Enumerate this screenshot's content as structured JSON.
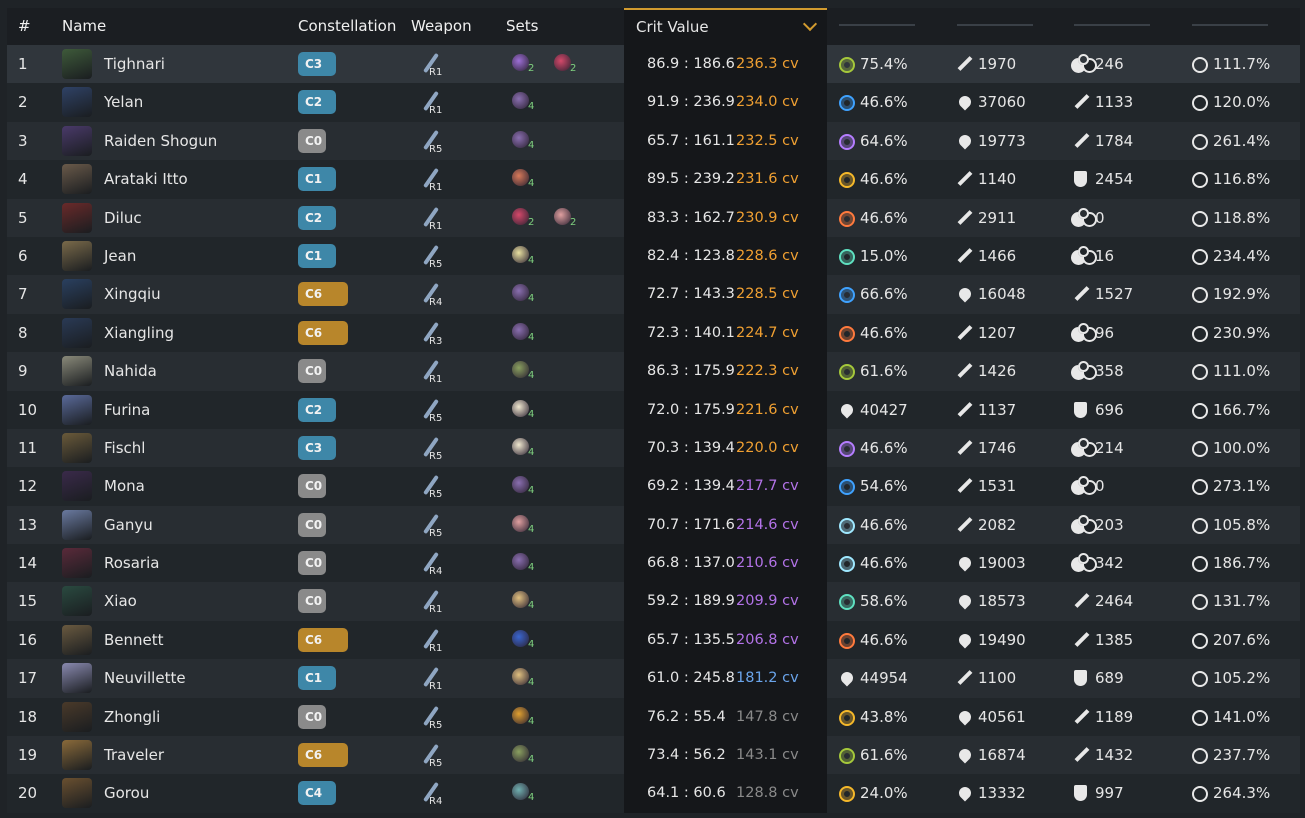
{
  "headers": {
    "num": "#",
    "name": "Name",
    "constellation": "Constellation",
    "weapon": "Weapon",
    "sets": "Sets",
    "crit": "Crit Value"
  },
  "colors": {
    "c_blue": "#3e87a8",
    "c_gray": "#8a8a8a",
    "c_gold": "#b8862b",
    "cv_orange": "#f0a032",
    "cv_purple": "#b373e8",
    "cv_blue": "#6aa4ea",
    "cv_gray": "#8a8a8a"
  },
  "rows": [
    {
      "n": "1",
      "name": "Tighnari",
      "c": "C3",
      "ct": "blue",
      "r": "R1",
      "sets": [
        {
          "k": "2",
          "col": "#9d6fd6"
        },
        {
          "k": "2",
          "col": "#d4496a"
        }
      ],
      "ratio": "86.9 : 186.6",
      "cv": "236.3 cv",
      "cvc": "orange",
      "s": [
        {
          "i": "dendro-icon",
          "v": "75.4%"
        },
        {
          "i": "atk-icon",
          "v": "1970"
        },
        {
          "i": "em-icon",
          "v": "246"
        },
        {
          "i": "er-icon",
          "v": "111.7%"
        }
      ]
    },
    {
      "n": "2",
      "name": "Yelan",
      "c": "C2",
      "ct": "blue",
      "r": "R1",
      "sets": [
        {
          "k": "4",
          "col": "#8a6fb0"
        }
      ],
      "ratio": "91.9 : 236.9",
      "cv": "234.0 cv",
      "cvc": "orange",
      "s": [
        {
          "i": "hydro-icon",
          "v": "46.6%"
        },
        {
          "i": "hp-icon",
          "v": "37060"
        },
        {
          "i": "atk-icon",
          "v": "1133"
        },
        {
          "i": "er-icon",
          "v": "120.0%"
        }
      ]
    },
    {
      "n": "3",
      "name": "Raiden Shogun",
      "c": "C0",
      "ct": "gray",
      "r": "R5",
      "sets": [
        {
          "k": "4",
          "col": "#8a6fb0"
        }
      ],
      "ratio": "65.7 : 161.1",
      "cv": "232.5 cv",
      "cvc": "orange",
      "s": [
        {
          "i": "electro-icon",
          "v": "64.6%"
        },
        {
          "i": "hp-icon",
          "v": "19773"
        },
        {
          "i": "atk-icon",
          "v": "1784"
        },
        {
          "i": "er-icon",
          "v": "261.4%"
        }
      ]
    },
    {
      "n": "4",
      "name": "Arataki Itto",
      "c": "C1",
      "ct": "blue",
      "r": "R1",
      "sets": [
        {
          "k": "4",
          "col": "#d77a5a"
        }
      ],
      "ratio": "89.5 : 239.2",
      "cv": "231.6 cv",
      "cvc": "orange",
      "s": [
        {
          "i": "geo-icon",
          "v": "46.6%"
        },
        {
          "i": "atk-icon",
          "v": "1140"
        },
        {
          "i": "def-icon",
          "v": "2454"
        },
        {
          "i": "er-icon",
          "v": "116.8%"
        }
      ]
    },
    {
      "n": "5",
      "name": "Diluc",
      "c": "C2",
      "ct": "blue",
      "r": "R1",
      "sets": [
        {
          "k": "2",
          "col": "#d4496a"
        },
        {
          "k": "2",
          "col": "#e0a0a0"
        }
      ],
      "ratio": "83.3 : 162.7",
      "cv": "230.9 cv",
      "cvc": "orange",
      "s": [
        {
          "i": "pyro-icon",
          "v": "46.6%"
        },
        {
          "i": "atk-icon",
          "v": "2911"
        },
        {
          "i": "em-icon",
          "v": "0"
        },
        {
          "i": "er-icon",
          "v": "118.8%"
        }
      ]
    },
    {
      "n": "6",
      "name": "Jean",
      "c": "C1",
      "ct": "blue",
      "r": "R5",
      "sets": [
        {
          "k": "4",
          "col": "#e8e0a0"
        }
      ],
      "ratio": "82.4 : 123.8",
      "cv": "228.6 cv",
      "cvc": "orange",
      "s": [
        {
          "i": "anemo-icon",
          "v": "15.0%"
        },
        {
          "i": "atk-icon",
          "v": "1466"
        },
        {
          "i": "em-icon",
          "v": "16"
        },
        {
          "i": "er-icon",
          "v": "234.4%"
        }
      ]
    },
    {
      "n": "7",
      "name": "Xingqiu",
      "c": "C6",
      "ct": "gold",
      "r": "R4",
      "sets": [
        {
          "k": "4",
          "col": "#8a6fb0"
        }
      ],
      "ratio": "72.7 : 143.3",
      "cv": "228.5 cv",
      "cvc": "orange",
      "s": [
        {
          "i": "hydro-icon",
          "v": "66.6%"
        },
        {
          "i": "hp-icon",
          "v": "16048"
        },
        {
          "i": "atk-icon",
          "v": "1527"
        },
        {
          "i": "er-icon",
          "v": "192.9%"
        }
      ]
    },
    {
      "n": "8",
      "name": "Xiangling",
      "c": "C6",
      "ct": "gold",
      "r": "R3",
      "sets": [
        {
          "k": "4",
          "col": "#8a6fb0"
        }
      ],
      "ratio": "72.3 : 140.1",
      "cv": "224.7 cv",
      "cvc": "orange",
      "s": [
        {
          "i": "pyro-icon",
          "v": "46.6%"
        },
        {
          "i": "atk-icon",
          "v": "1207"
        },
        {
          "i": "em-icon",
          "v": "96"
        },
        {
          "i": "er-icon",
          "v": "230.9%"
        }
      ]
    },
    {
      "n": "9",
      "name": "Nahida",
      "c": "C0",
      "ct": "gray",
      "r": "R1",
      "sets": [
        {
          "k": "4",
          "col": "#8aa060"
        }
      ],
      "ratio": "86.3 : 175.9",
      "cv": "222.3 cv",
      "cvc": "orange",
      "s": [
        {
          "i": "dendro-icon",
          "v": "61.6%"
        },
        {
          "i": "atk-icon",
          "v": "1426"
        },
        {
          "i": "em-icon",
          "v": "358"
        },
        {
          "i": "er-icon",
          "v": "111.0%"
        }
      ]
    },
    {
      "n": "10",
      "name": "Furina",
      "c": "C2",
      "ct": "blue",
      "r": "R5",
      "sets": [
        {
          "k": "4",
          "col": "#f0e8d0"
        }
      ],
      "ratio": "72.0 : 175.9",
      "cv": "221.6 cv",
      "cvc": "orange",
      "s": [
        {
          "i": "hp-icon",
          "v": "40427"
        },
        {
          "i": "atk-icon",
          "v": "1137"
        },
        {
          "i": "def-icon",
          "v": "696"
        },
        {
          "i": "er-icon",
          "v": "166.7%"
        }
      ]
    },
    {
      "n": "11",
      "name": "Fischl",
      "c": "C3",
      "ct": "blue",
      "r": "R5",
      "sets": [
        {
          "k": "4",
          "col": "#f0e8d0"
        }
      ],
      "ratio": "70.3 : 139.4",
      "cv": "220.0 cv",
      "cvc": "orange",
      "s": [
        {
          "i": "electro-icon",
          "v": "46.6%"
        },
        {
          "i": "atk-icon",
          "v": "1746"
        },
        {
          "i": "em-icon",
          "v": "214"
        },
        {
          "i": "er-icon",
          "v": "100.0%"
        }
      ]
    },
    {
      "n": "12",
      "name": "Mona",
      "c": "C0",
      "ct": "gray",
      "r": "R5",
      "sets": [
        {
          "k": "4",
          "col": "#8a6fb0"
        }
      ],
      "ratio": "69.2 : 139.4",
      "cv": "217.7 cv",
      "cvc": "purple",
      "s": [
        {
          "i": "hydro-icon",
          "v": "54.6%"
        },
        {
          "i": "atk-icon",
          "v": "1531"
        },
        {
          "i": "em-icon",
          "v": "0"
        },
        {
          "i": "er-icon",
          "v": "273.1%"
        }
      ]
    },
    {
      "n": "13",
      "name": "Ganyu",
      "c": "C0",
      "ct": "gray",
      "r": "R5",
      "sets": [
        {
          "k": "4",
          "col": "#e0a0a0"
        }
      ],
      "ratio": "70.7 : 171.6",
      "cv": "214.6 cv",
      "cvc": "purple",
      "s": [
        {
          "i": "cryo-icon",
          "v": "46.6%"
        },
        {
          "i": "atk-icon",
          "v": "2082"
        },
        {
          "i": "em-icon",
          "v": "203"
        },
        {
          "i": "er-icon",
          "v": "105.8%"
        }
      ]
    },
    {
      "n": "14",
      "name": "Rosaria",
      "c": "C0",
      "ct": "gray",
      "r": "R4",
      "sets": [
        {
          "k": "4",
          "col": "#8a6fb0"
        }
      ],
      "ratio": "66.8 : 137.0",
      "cv": "210.6 cv",
      "cvc": "purple",
      "s": [
        {
          "i": "cryo-icon",
          "v": "46.6%"
        },
        {
          "i": "hp-icon",
          "v": "19003"
        },
        {
          "i": "em-icon",
          "v": "342"
        },
        {
          "i": "er-icon",
          "v": "186.7%"
        }
      ]
    },
    {
      "n": "15",
      "name": "Xiao",
      "c": "C0",
      "ct": "gray",
      "r": "R1",
      "sets": [
        {
          "k": "4",
          "col": "#e0c080"
        }
      ],
      "ratio": "59.2 : 189.9",
      "cv": "209.9 cv",
      "cvc": "purple",
      "s": [
        {
          "i": "anemo-icon",
          "v": "58.6%"
        },
        {
          "i": "hp-icon",
          "v": "18573"
        },
        {
          "i": "atk-icon",
          "v": "2464"
        },
        {
          "i": "er-icon",
          "v": "131.7%"
        }
      ]
    },
    {
      "n": "16",
      "name": "Bennett",
      "c": "C6",
      "ct": "gold",
      "r": "R1",
      "sets": [
        {
          "k": "4",
          "col": "#3a66d0"
        }
      ],
      "ratio": "65.7 : 135.5",
      "cv": "206.8 cv",
      "cvc": "purple",
      "s": [
        {
          "i": "pyro-icon",
          "v": "46.6%"
        },
        {
          "i": "hp-icon",
          "v": "19490"
        },
        {
          "i": "atk-icon",
          "v": "1385"
        },
        {
          "i": "er-icon",
          "v": "207.6%"
        }
      ]
    },
    {
      "n": "17",
      "name": "Neuvillette",
      "c": "C1",
      "ct": "blue",
      "r": "R1",
      "sets": [
        {
          "k": "4",
          "col": "#e0c080"
        }
      ],
      "ratio": "61.0 : 245.8",
      "cv": "181.2 cv",
      "cvc": "blue",
      "s": [
        {
          "i": "hp-icon",
          "v": "44954"
        },
        {
          "i": "atk-icon",
          "v": "1100"
        },
        {
          "i": "def-icon",
          "v": "689"
        },
        {
          "i": "er-icon",
          "v": "105.2%"
        }
      ]
    },
    {
      "n": "18",
      "name": "Zhongli",
      "c": "C0",
      "ct": "gray",
      "r": "R5",
      "sets": [
        {
          "k": "4",
          "col": "#e0a030"
        }
      ],
      "ratio": "76.2 : 55.4",
      "cv": "147.8 cv",
      "cvc": "gray",
      "s": [
        {
          "i": "geo-icon",
          "v": "43.8%"
        },
        {
          "i": "hp-icon",
          "v": "40561"
        },
        {
          "i": "atk-icon",
          "v": "1189"
        },
        {
          "i": "er-icon",
          "v": "141.0%"
        }
      ]
    },
    {
      "n": "19",
      "name": "Traveler",
      "c": "C6",
      "ct": "gold",
      "r": "R5",
      "sets": [
        {
          "k": "4",
          "col": "#8aa060"
        }
      ],
      "ratio": "73.4 : 56.2",
      "cv": "143.1 cv",
      "cvc": "gray",
      "s": [
        {
          "i": "dendro-icon",
          "v": "61.6%"
        },
        {
          "i": "hp-icon",
          "v": "16874"
        },
        {
          "i": "atk-icon",
          "v": "1432"
        },
        {
          "i": "er-icon",
          "v": "237.7%"
        }
      ]
    },
    {
      "n": "20",
      "name": "Gorou",
      "c": "C4",
      "ct": "blue",
      "r": "R4",
      "sets": [
        {
          "k": "4",
          "col": "#70b0b0"
        }
      ],
      "ratio": "64.1 : 60.6",
      "cv": "128.8 cv",
      "cvc": "gray",
      "s": [
        {
          "i": "geo-icon",
          "v": "24.0%"
        },
        {
          "i": "hp-icon",
          "v": "13332"
        },
        {
          "i": "def-icon",
          "v": "997"
        },
        {
          "i": "er-icon",
          "v": "264.3%"
        }
      ]
    }
  ]
}
